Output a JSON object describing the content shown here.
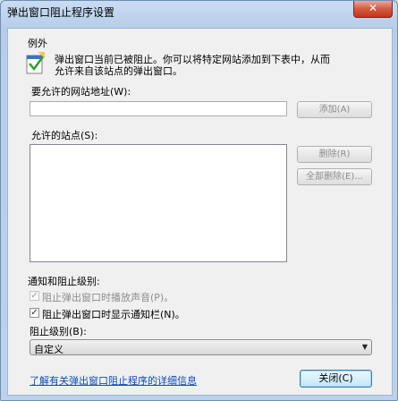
{
  "window": {
    "title": "弹出窗口阻止程序设置",
    "close_glyph": "✕"
  },
  "exceptions": {
    "section_label": "例外",
    "info_line1": "弹出窗口当前已被阻止。你可以将特定网站添加到下表中，从而",
    "info_line2": "允许来自该站点的弹出窗口。",
    "icon": "shield-warning-icon",
    "address_label": "要允许的网站地址(W):",
    "address_value": "",
    "add_button": "添加(A)",
    "allowed_label": "允许的站点(S):",
    "allowed_sites": [],
    "remove_button": "删除(R)",
    "remove_all_button": "全部删除(E)..."
  },
  "notification": {
    "section_label": "通知和阻止级别:",
    "play_sound_label": "阻止弹出窗口时播放声音(P)。",
    "play_sound_checked": true,
    "play_sound_enabled": false,
    "show_bar_label": "阻止弹出窗口时显示通知栏(N)。",
    "show_bar_checked": true,
    "level_label": "阻止级别(B):",
    "level_value": "自定义"
  },
  "footer": {
    "learn_more_link": "了解有关弹出窗口阻止程序的详细信息",
    "close_button": "关闭(C)"
  },
  "colors": {
    "title_bg": "#bcd2ec",
    "client_bg": "#f0f0f0",
    "link": "#0a4dbd",
    "close_red": "#c2361d"
  }
}
